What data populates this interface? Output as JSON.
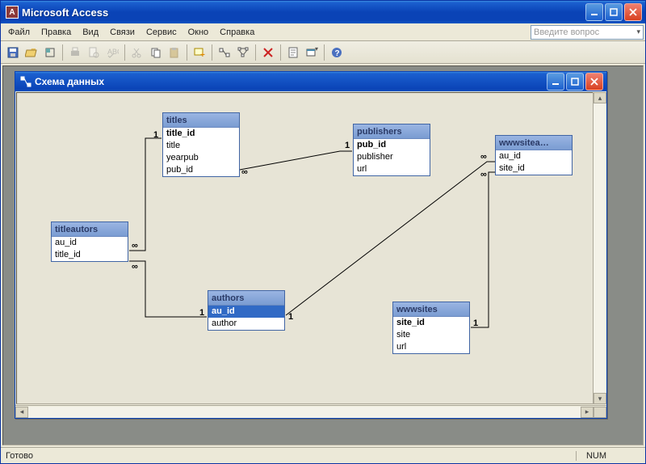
{
  "app": {
    "title": "Microsoft Access"
  },
  "menubar": {
    "items": [
      "Файл",
      "Правка",
      "Вид",
      "Связи",
      "Сервис",
      "Окно",
      "Справка"
    ],
    "question_placeholder": "Введите вопрос"
  },
  "toolbar": {
    "icons": [
      "save",
      "open",
      "print-area",
      "print",
      "print-preview",
      "spelling",
      "cut",
      "copy",
      "paste",
      "add-table",
      "show-table",
      "direct-rel",
      "all-rel",
      "delete",
      "props",
      "new-object",
      "help"
    ]
  },
  "rel_window": {
    "title": "Схема данных"
  },
  "tables": {
    "titleautors": {
      "title": "titleautors",
      "fields": [
        "au_id",
        "title_id"
      ],
      "pk": []
    },
    "titles": {
      "title": "titles",
      "fields": [
        "title_id",
        "title",
        "yearpub",
        "pub_id"
      ],
      "pk": [
        "title_id"
      ]
    },
    "publishers": {
      "title": "publishers",
      "fields": [
        "pub_id",
        "publisher",
        "url"
      ],
      "pk": [
        "pub_id"
      ]
    },
    "wwwsitea": {
      "title": "wwwsitea…",
      "fields": [
        "au_id",
        "site_id"
      ],
      "pk": []
    },
    "authors": {
      "title": "authors",
      "fields": [
        "au_id",
        "author"
      ],
      "pk": [
        "au_id"
      ],
      "selected": "au_id"
    },
    "wwwsites": {
      "title": "wwwsites",
      "fields": [
        "site_id",
        "site",
        "url"
      ],
      "pk": [
        "site_id"
      ]
    }
  },
  "relations_cardinality": {
    "one": "1",
    "many": "∞"
  },
  "statusbar": {
    "ready": "Готово",
    "num": "NUM"
  }
}
